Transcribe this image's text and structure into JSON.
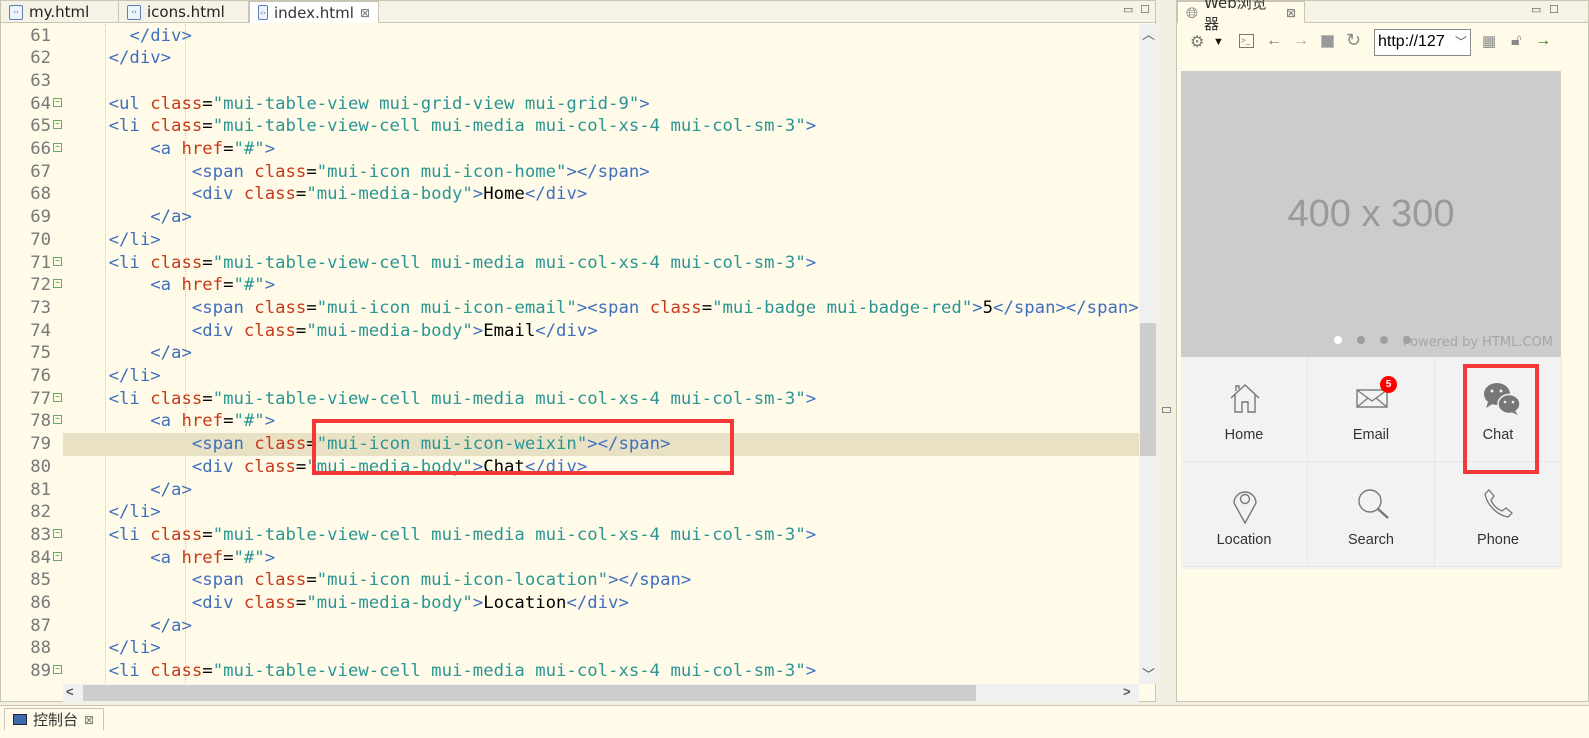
{
  "editor": {
    "tabs": [
      {
        "label": "my.html",
        "active": false
      },
      {
        "label": "icons.html",
        "active": false
      },
      {
        "label": "index.html",
        "active": true
      }
    ],
    "close_glyph": "⊠",
    "highlighted_line": 79,
    "lines": [
      {
        "n": 61,
        "fold": false,
        "t": [
          [
            "ws",
            "      "
          ],
          [
            "tag",
            "</div>"
          ]
        ]
      },
      {
        "n": 62,
        "fold": false,
        "t": [
          [
            "ws",
            "    "
          ],
          [
            "tag",
            "</div>"
          ]
        ]
      },
      {
        "n": 63,
        "fold": false,
        "t": []
      },
      {
        "n": 64,
        "fold": true,
        "t": [
          [
            "ws",
            "    "
          ],
          [
            "tag",
            "<ul "
          ],
          [
            "attr",
            "class"
          ],
          [
            "text",
            "="
          ],
          [
            "val",
            "\"mui-table-view mui-grid-view mui-grid-9\""
          ],
          [
            "tag",
            ">"
          ]
        ]
      },
      {
        "n": 65,
        "fold": true,
        "t": [
          [
            "ws",
            "    "
          ],
          [
            "tag",
            "<li "
          ],
          [
            "attr",
            "class"
          ],
          [
            "text",
            "="
          ],
          [
            "val",
            "\"mui-table-view-cell mui-media mui-col-xs-4 mui-col-sm-3\""
          ],
          [
            "tag",
            ">"
          ]
        ]
      },
      {
        "n": 66,
        "fold": true,
        "t": [
          [
            "ws",
            "        "
          ],
          [
            "tag",
            "<a "
          ],
          [
            "attr",
            "href"
          ],
          [
            "text",
            "="
          ],
          [
            "val",
            "\"#\""
          ],
          [
            "tag",
            ">"
          ]
        ]
      },
      {
        "n": 67,
        "fold": false,
        "t": [
          [
            "ws",
            "            "
          ],
          [
            "tag",
            "<span "
          ],
          [
            "attr",
            "class"
          ],
          [
            "text",
            "="
          ],
          [
            "val",
            "\"mui-icon mui-icon-home\""
          ],
          [
            "tag",
            "></span>"
          ]
        ]
      },
      {
        "n": 68,
        "fold": false,
        "t": [
          [
            "ws",
            "            "
          ],
          [
            "tag",
            "<div "
          ],
          [
            "attr",
            "class"
          ],
          [
            "text",
            "="
          ],
          [
            "val",
            "\"mui-media-body\""
          ],
          [
            "tag",
            ">"
          ],
          [
            "text",
            "Home"
          ],
          [
            "tag",
            "</div>"
          ]
        ]
      },
      {
        "n": 69,
        "fold": false,
        "t": [
          [
            "ws",
            "        "
          ],
          [
            "tag",
            "</a>"
          ]
        ]
      },
      {
        "n": 70,
        "fold": false,
        "t": [
          [
            "ws",
            "    "
          ],
          [
            "tag",
            "</li>"
          ]
        ]
      },
      {
        "n": 71,
        "fold": true,
        "t": [
          [
            "ws",
            "    "
          ],
          [
            "tag",
            "<li "
          ],
          [
            "attr",
            "class"
          ],
          [
            "text",
            "="
          ],
          [
            "val",
            "\"mui-table-view-cell mui-media mui-col-xs-4 mui-col-sm-3\""
          ],
          [
            "tag",
            ">"
          ]
        ]
      },
      {
        "n": 72,
        "fold": true,
        "t": [
          [
            "ws",
            "        "
          ],
          [
            "tag",
            "<a "
          ],
          [
            "attr",
            "href"
          ],
          [
            "text",
            "="
          ],
          [
            "val",
            "\"#\""
          ],
          [
            "tag",
            ">"
          ]
        ]
      },
      {
        "n": 73,
        "fold": false,
        "t": [
          [
            "ws",
            "            "
          ],
          [
            "tag",
            "<span "
          ],
          [
            "attr",
            "class"
          ],
          [
            "text",
            "="
          ],
          [
            "val",
            "\"mui-icon mui-icon-email\""
          ],
          [
            "tag",
            "><span "
          ],
          [
            "attr",
            "class"
          ],
          [
            "text",
            "="
          ],
          [
            "val",
            "\"mui-badge mui-badge-red\""
          ],
          [
            "tag",
            ">"
          ],
          [
            "text",
            "5"
          ],
          [
            "tag",
            "</span></span>"
          ]
        ]
      },
      {
        "n": 74,
        "fold": false,
        "t": [
          [
            "ws",
            "            "
          ],
          [
            "tag",
            "<div "
          ],
          [
            "attr",
            "class"
          ],
          [
            "text",
            "="
          ],
          [
            "val",
            "\"mui-media-body\""
          ],
          [
            "tag",
            ">"
          ],
          [
            "text",
            "Email"
          ],
          [
            "tag",
            "</div>"
          ]
        ]
      },
      {
        "n": 75,
        "fold": false,
        "t": [
          [
            "ws",
            "        "
          ],
          [
            "tag",
            "</a>"
          ]
        ]
      },
      {
        "n": 76,
        "fold": false,
        "t": [
          [
            "ws",
            "    "
          ],
          [
            "tag",
            "</li>"
          ]
        ]
      },
      {
        "n": 77,
        "fold": true,
        "t": [
          [
            "ws",
            "    "
          ],
          [
            "tag",
            "<li "
          ],
          [
            "attr",
            "class"
          ],
          [
            "text",
            "="
          ],
          [
            "val",
            "\"mui-table-view-cell mui-media mui-col-xs-4 mui-col-sm-3\""
          ],
          [
            "tag",
            ">"
          ]
        ]
      },
      {
        "n": 78,
        "fold": true,
        "t": [
          [
            "ws",
            "        "
          ],
          [
            "tag",
            "<a "
          ],
          [
            "attr",
            "href"
          ],
          [
            "text",
            "="
          ],
          [
            "val",
            "\"#\""
          ],
          [
            "tag",
            ">"
          ]
        ]
      },
      {
        "n": 79,
        "fold": false,
        "t": [
          [
            "ws",
            "            "
          ],
          [
            "tag",
            "<span "
          ],
          [
            "attr",
            "class"
          ],
          [
            "text",
            "="
          ],
          [
            "val",
            "\"mui-icon mui-icon-weixin\""
          ],
          [
            "tag",
            "></span>"
          ]
        ]
      },
      {
        "n": 80,
        "fold": false,
        "t": [
          [
            "ws",
            "            "
          ],
          [
            "tag",
            "<div "
          ],
          [
            "attr",
            "class"
          ],
          [
            "text",
            "="
          ],
          [
            "val",
            "\"mui-media-body\""
          ],
          [
            "tag",
            ">"
          ],
          [
            "text",
            "Chat"
          ],
          [
            "tag",
            "</div>"
          ]
        ]
      },
      {
        "n": 81,
        "fold": false,
        "t": [
          [
            "ws",
            "        "
          ],
          [
            "tag",
            "</a>"
          ]
        ]
      },
      {
        "n": 82,
        "fold": false,
        "t": [
          [
            "ws",
            "    "
          ],
          [
            "tag",
            "</li>"
          ]
        ]
      },
      {
        "n": 83,
        "fold": true,
        "t": [
          [
            "ws",
            "    "
          ],
          [
            "tag",
            "<li "
          ],
          [
            "attr",
            "class"
          ],
          [
            "text",
            "="
          ],
          [
            "val",
            "\"mui-table-view-cell mui-media mui-col-xs-4 mui-col-sm-3\""
          ],
          [
            "tag",
            ">"
          ]
        ]
      },
      {
        "n": 84,
        "fold": true,
        "t": [
          [
            "ws",
            "        "
          ],
          [
            "tag",
            "<a "
          ],
          [
            "attr",
            "href"
          ],
          [
            "text",
            "="
          ],
          [
            "val",
            "\"#\""
          ],
          [
            "tag",
            ">"
          ]
        ]
      },
      {
        "n": 85,
        "fold": false,
        "t": [
          [
            "ws",
            "            "
          ],
          [
            "tag",
            "<span "
          ],
          [
            "attr",
            "class"
          ],
          [
            "text",
            "="
          ],
          [
            "val",
            "\"mui-icon mui-icon-location\""
          ],
          [
            "tag",
            "></span>"
          ]
        ]
      },
      {
        "n": 86,
        "fold": false,
        "t": [
          [
            "ws",
            "            "
          ],
          [
            "tag",
            "<div "
          ],
          [
            "attr",
            "class"
          ],
          [
            "text",
            "="
          ],
          [
            "val",
            "\"mui-media-body\""
          ],
          [
            "tag",
            ">"
          ],
          [
            "text",
            "Location"
          ],
          [
            "tag",
            "</div>"
          ]
        ]
      },
      {
        "n": 87,
        "fold": false,
        "t": [
          [
            "ws",
            "        "
          ],
          [
            "tag",
            "</a>"
          ]
        ]
      },
      {
        "n": 88,
        "fold": false,
        "t": [
          [
            "ws",
            "    "
          ],
          [
            "tag",
            "</li>"
          ]
        ]
      },
      {
        "n": 89,
        "fold": true,
        "t": [
          [
            "ws",
            "    "
          ],
          [
            "tag",
            "<li "
          ],
          [
            "attr",
            "class"
          ],
          [
            "text",
            "="
          ],
          [
            "val",
            "\"mui-table-view-cell mui-media mui-col-xs-4 mui-col-sm-3\""
          ],
          [
            "tag",
            ">"
          ]
        ]
      }
    ]
  },
  "browser": {
    "tab_label": "Web浏览器",
    "url": "http://127",
    "placeholder_image_text": "400 x 300",
    "watermark": "Powered by HTML.COM",
    "slide_count": 4,
    "active_slide": 1,
    "grid": [
      {
        "label": "Home",
        "icon": "home-icon"
      },
      {
        "label": "Email",
        "icon": "email-icon",
        "badge": "5"
      },
      {
        "label": "Chat",
        "icon": "wechat-icon"
      },
      {
        "label": "Location",
        "icon": "location-icon"
      },
      {
        "label": "Search",
        "icon": "search-icon"
      },
      {
        "label": "Phone",
        "icon": "phone-icon"
      }
    ],
    "badge_color": "#ff0000"
  },
  "console": {
    "tab_label": "控制台"
  },
  "colors": {
    "highlight_box": "#f43838",
    "tag": "#3f6fbf",
    "attr": "#c8391a",
    "value": "#2a9595",
    "editor_bg": "#fffbe8"
  }
}
